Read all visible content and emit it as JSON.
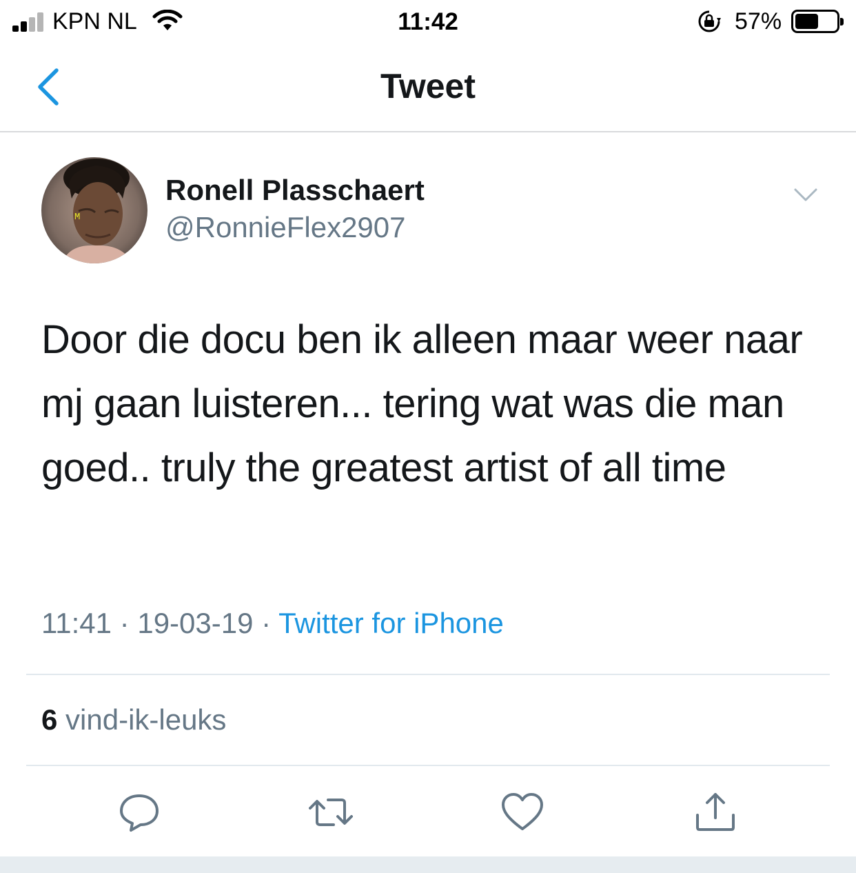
{
  "status_bar": {
    "carrier": "KPN NL",
    "time": "11:42",
    "battery_percent": "57%",
    "battery_level": 0.57,
    "signal_bars": 2,
    "icons": [
      "signal-icon",
      "wifi-icon",
      "orientation-lock-icon",
      "battery-icon"
    ]
  },
  "nav": {
    "title": "Tweet",
    "back_icon": "chevron-left-icon"
  },
  "tweet": {
    "author_name": "Ronell Plasschaert",
    "author_handle": "@RonnieFlex2907",
    "text": "Door die docu ben ik alleen maar weer naar mj gaan luisteren... tering wat was die man goed.. truly the greatest artist of all time",
    "time": "11:41",
    "date": "19-03-19",
    "separator": "·",
    "source": "Twitter for iPhone",
    "like_count": "6",
    "like_label": "vind-ik-leuks"
  },
  "actions": [
    {
      "name": "reply-button",
      "icon": "reply-icon"
    },
    {
      "name": "retweet-button",
      "icon": "retweet-icon"
    },
    {
      "name": "like-button",
      "icon": "heart-icon"
    },
    {
      "name": "share-button",
      "icon": "share-icon"
    }
  ],
  "colors": {
    "accent": "#1b95e0",
    "secondary_text": "#657786",
    "primary_text": "#14171a",
    "divider": "#e1e8ed"
  }
}
